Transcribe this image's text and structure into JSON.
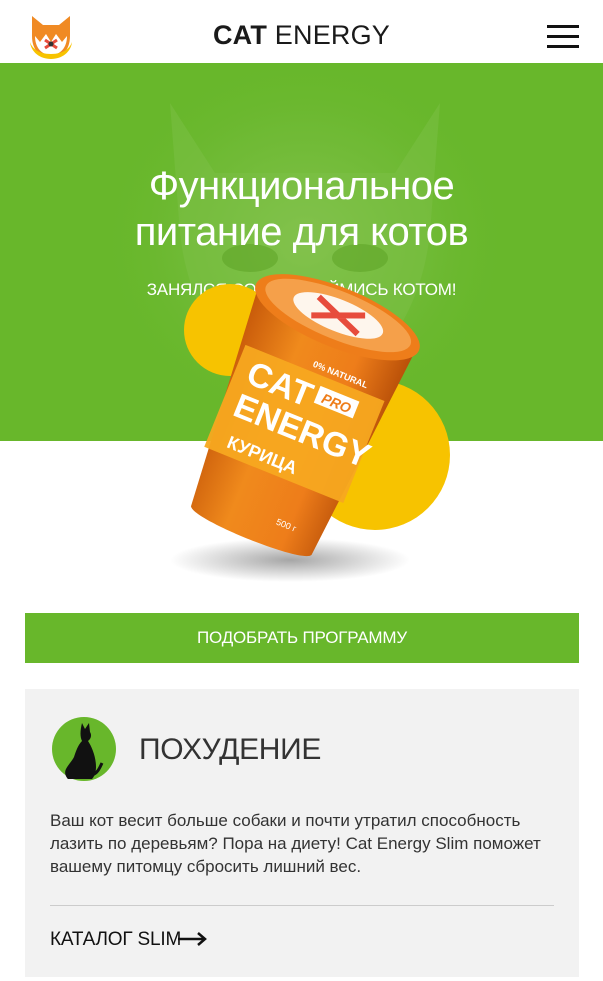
{
  "header": {
    "brand_bold": "CAT",
    "brand_light": "ENERGY",
    "logo_icon": "cat-logo-icon",
    "menu_icon": "hamburger-menu-icon"
  },
  "hero": {
    "title_line1": "Функциональное",
    "title_line2": "питание для котов",
    "subtitle": "ЗАНЯЛСЯ СОБОЙ? ЗАЙМИСЬ КОТОМ!",
    "product": {
      "brand_line1": "CAT",
      "brand_line2": "ENERGY",
      "badge": "PRO",
      "flavor": "КУРИЦА",
      "natural": "0% NATURAL",
      "weight": "500 г"
    }
  },
  "cta": {
    "label": "ПОДОБРАТЬ ПРОГРАММУ"
  },
  "card": {
    "icon": "cat-silhouette-icon",
    "title": "ПОХУДЕНИЕ",
    "text": "Ваш кот весит больше собаки и почти утратил способность лазить по деревьям? Пора на диету! Cat Energy Slim поможет вашему питомцу сбросить лишний вес.",
    "link": "КАТАЛОГ SLIM",
    "arrow_icon": "arrow-right-icon"
  },
  "colors": {
    "accent_green": "#68b72b",
    "accent_yellow": "#f7c300",
    "accent_orange": "#ee7d1a"
  }
}
